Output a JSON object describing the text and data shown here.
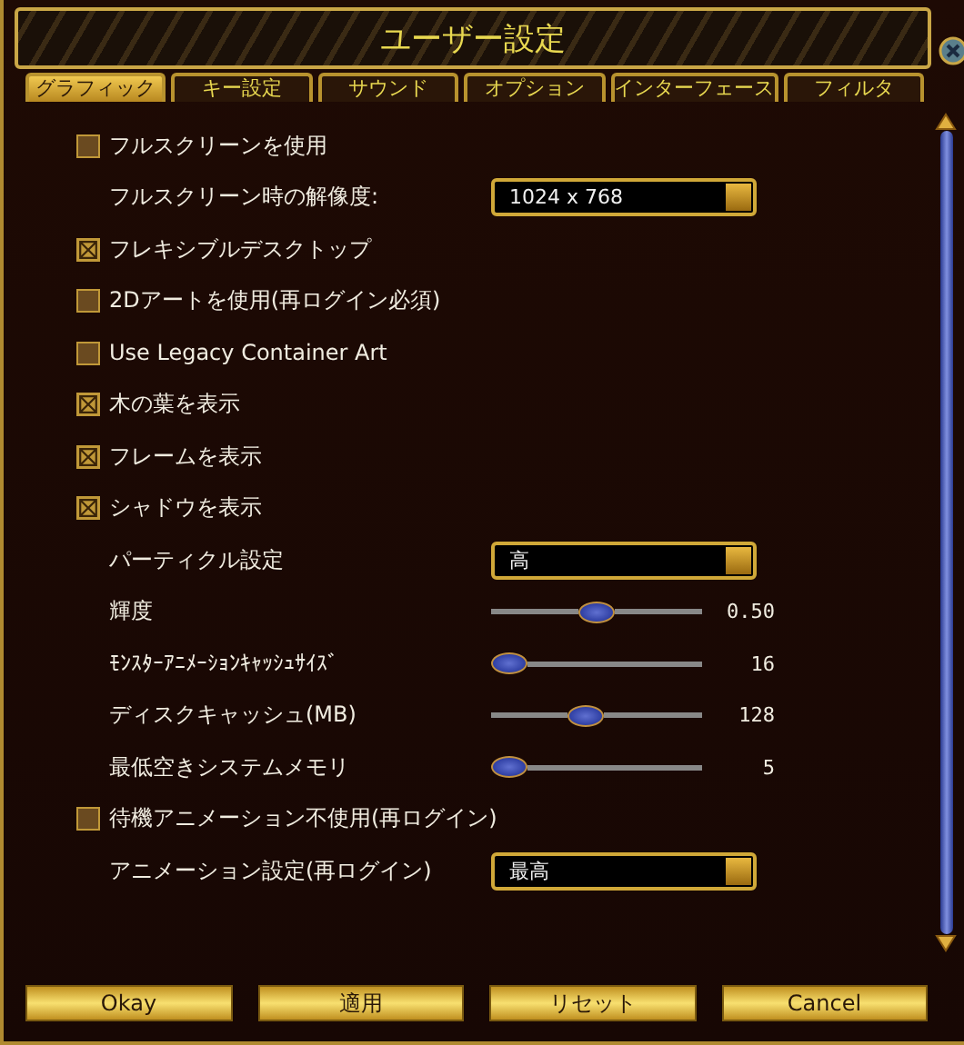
{
  "window": {
    "title": "ユーザー設定"
  },
  "tabs": [
    {
      "label": "グラフィック",
      "selected": true
    },
    {
      "label": "キー設定",
      "selected": false
    },
    {
      "label": "サウンド",
      "selected": false
    },
    {
      "label": "オプション",
      "selected": false
    },
    {
      "label": "インターフェース",
      "selected": false
    },
    {
      "label": "フィルタ",
      "selected": false
    }
  ],
  "settings": [
    {
      "kind": "checkbox",
      "label": "フルスクリーンを使用",
      "checked": false
    },
    {
      "kind": "dropdown",
      "label": "フルスクリーン時の解像度:",
      "value": "1024 x 768"
    },
    {
      "kind": "checkbox",
      "label": "フレキシブルデスクトップ",
      "checked": true
    },
    {
      "kind": "checkbox",
      "label": "2Dアートを使用(再ログイン必須)",
      "checked": false
    },
    {
      "kind": "checkbox",
      "label": "Use Legacy Container Art",
      "checked": false
    },
    {
      "kind": "checkbox",
      "label": "木の葉を表示",
      "checked": true
    },
    {
      "kind": "checkbox",
      "label": "フレームを表示",
      "checked": true
    },
    {
      "kind": "checkbox",
      "label": "シャドウを表示",
      "checked": true
    },
    {
      "kind": "dropdown",
      "label": "パーティクル設定",
      "value": "高"
    },
    {
      "kind": "slider",
      "label": "輝度",
      "level": 0.5,
      "reading": "0.50"
    },
    {
      "kind": "slider",
      "label": "ﾓﾝｽﾀｰｱﾆﾒｰｼｮﾝｷｬｯｼｭｻｲｽﾞ",
      "level": 0,
      "reading": "16"
    },
    {
      "kind": "slider",
      "label": "ディスクキャッシュ(MB)",
      "level": 0.44,
      "reading": "128"
    },
    {
      "kind": "slider",
      "label": "最低空きシステムメモリ",
      "level": 0,
      "reading": "5"
    },
    {
      "kind": "checkbox",
      "label": "待機アニメーション不使用(再ログイン)",
      "checked": false
    },
    {
      "kind": "dropdown",
      "label": "アニメーション設定(再ログイン)",
      "value": "最高"
    }
  ],
  "buttons": [
    "Okay",
    "適用",
    "リセット",
    "Cancel"
  ]
}
